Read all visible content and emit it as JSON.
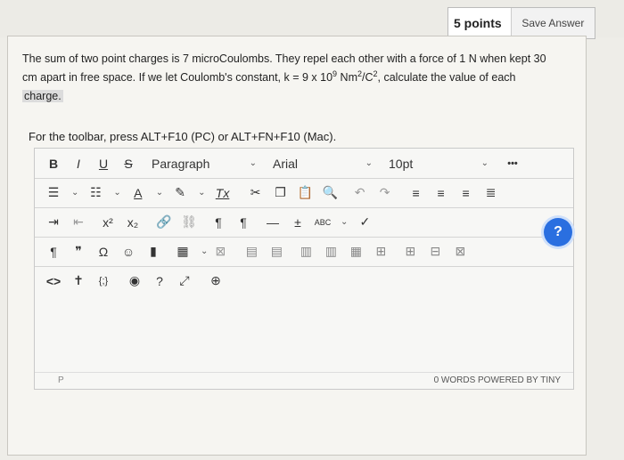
{
  "header": {
    "points": "5 points",
    "save_label": "Save Answer"
  },
  "question": {
    "line1": "The sum of two point charges is 7 microCoulombs. They repel each other with a force of 1 N when kept 30",
    "line2_a": "cm apart in free space. If we let Coulomb's constant, k = 9 x 10",
    "line2_exp": "9",
    "line2_b": " Nm",
    "line2_exp2": "2",
    "line2_c": "/C",
    "line2_exp3": "2",
    "line2_d": ", calculate the value of each",
    "line3": "charge."
  },
  "instruction": "For the toolbar, press ALT+F10 (PC) or ALT+FN+F10 (Mac).",
  "toolbar": {
    "row1": {
      "bold": "B",
      "italic": "I",
      "underline": "U",
      "strike": "S",
      "block_format": "Paragraph",
      "font_family": "Arial",
      "font_size": "10pt",
      "more": "•••"
    },
    "row2": {
      "clear_format": "Tx",
      "font_color": "A"
    },
    "row3": {
      "superscript": "x²",
      "subscript": "x₂",
      "ltr": "¶",
      "rtl": "¶",
      "hr": "—",
      "plus_minus": "±",
      "spell": "ABC",
      "check": "✓"
    },
    "row4": {
      "pilcrow": "¶",
      "quote": "❞",
      "omega": "Ω"
    },
    "row5": {
      "code": "<>",
      "accessibility": "✝",
      "braces": "{;}"
    }
  },
  "status": {
    "path": "P",
    "right": "0 WORDS  POWERED BY TINY"
  },
  "help_label": "?"
}
